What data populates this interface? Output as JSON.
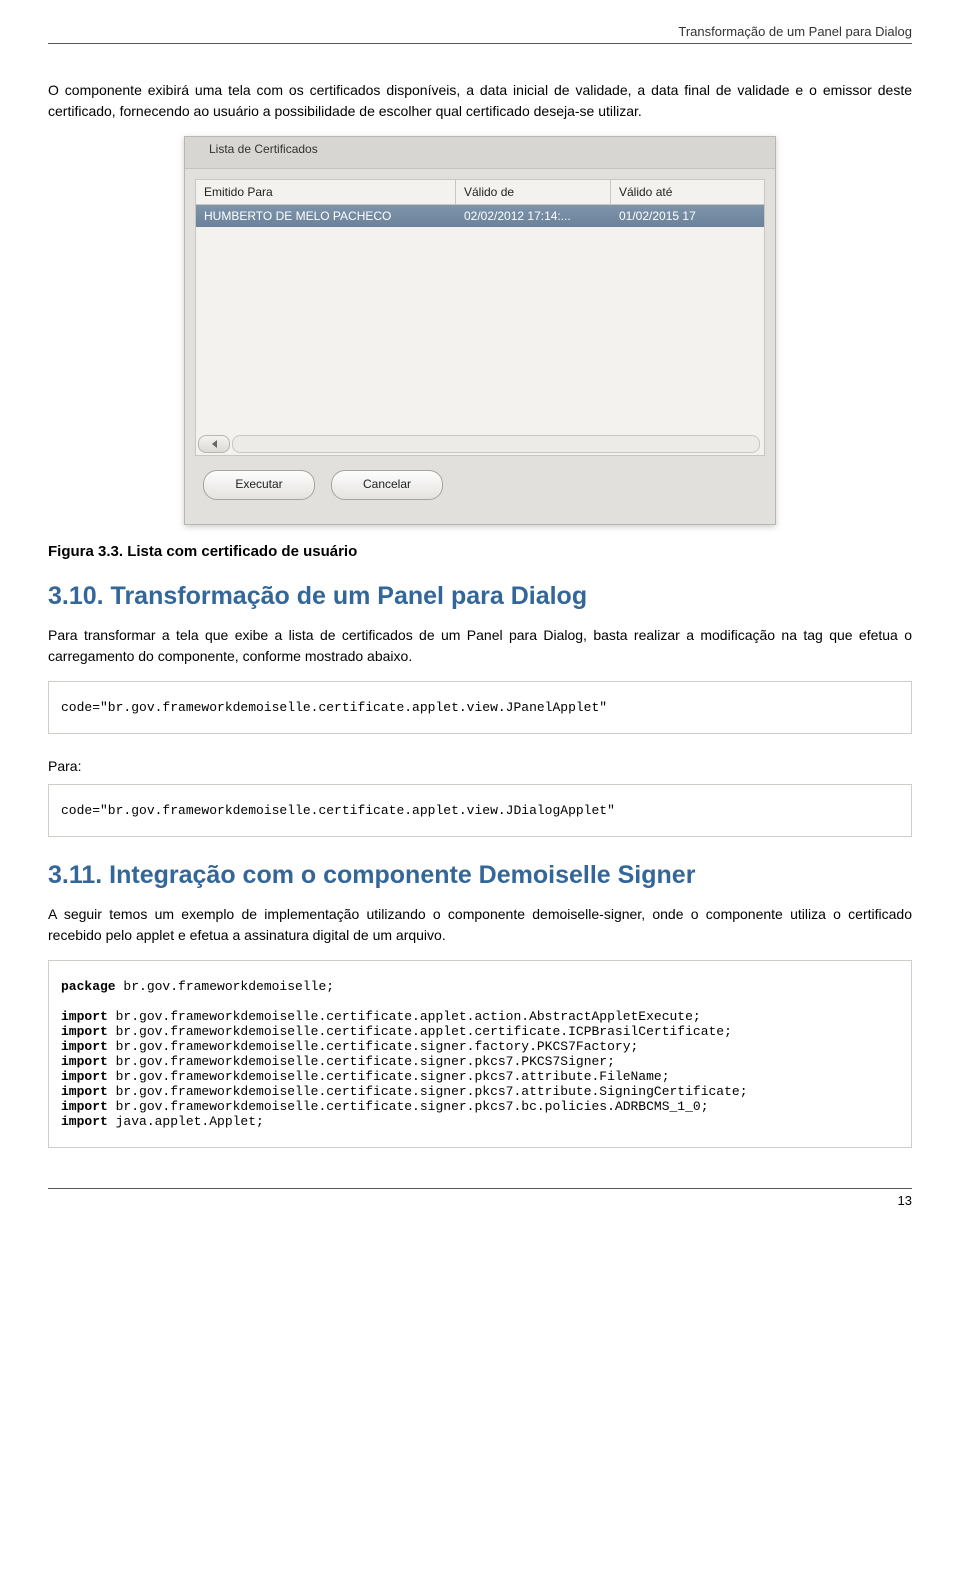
{
  "header": {
    "title": "Transformação de um Panel para Dialog"
  },
  "intro": "O componente exibirá uma tela com os certificados disponíveis, a data inicial de validade, a data final de validade e o emissor deste certificado, fornecendo ao usuário a possibilidade de escolher qual certificado deseja-se utilizar.",
  "dialog": {
    "title": "Lista de Certificados",
    "columns": {
      "c1": "Emitido Para",
      "c2": "Válido de",
      "c3": "Válido até"
    },
    "row": {
      "c1": "HUMBERTO DE MELO PACHECO",
      "c2": "02/02/2012 17:14:...",
      "c3": "01/02/2015 17"
    },
    "btn_exec": "Executar",
    "btn_cancel": "Cancelar"
  },
  "figure_caption": "Figura 3.3. Lista com certificado de usuário",
  "sec310": {
    "heading": "3.10. Transformação de um Panel para Dialog",
    "para": "Para transformar a tela que exibe a lista de certificados de um Panel para Dialog, basta realizar a modificação na tag que efetua o carregamento do componente, conforme mostrado abaixo.",
    "code1": "code=\"br.gov.frameworkdemoiselle.certificate.applet.view.JPanelApplet\"",
    "para_label": "Para:",
    "code2": "code=\"br.gov.frameworkdemoiselle.certificate.applet.view.JDialogApplet\""
  },
  "sec311": {
    "heading": "3.11. Integração com o componente Demoiselle Signer",
    "para": "A seguir temos um exemplo de implementação utilizando o componente demoiselle-signer, onde o componente utiliza o certificado recebido pelo applet e efetua a assinatura digital de um arquivo.",
    "code": {
      "l1a": "package",
      "l1b": " br.gov.frameworkdemoiselle;",
      "l2a": "import",
      "l2b": " br.gov.frameworkdemoiselle.certificate.applet.action.AbstractAppletExecute;",
      "l3a": "import",
      "l3b": " br.gov.frameworkdemoiselle.certificate.applet.certificate.ICPBrasilCertificate;",
      "l4a": "import",
      "l4b": " br.gov.frameworkdemoiselle.certificate.signer.factory.PKCS7Factory;",
      "l5a": "import",
      "l5b": " br.gov.frameworkdemoiselle.certificate.signer.pkcs7.PKCS7Signer;",
      "l6a": "import",
      "l6b": " br.gov.frameworkdemoiselle.certificate.signer.pkcs7.attribute.FileName;",
      "l7a": "import",
      "l7b": " br.gov.frameworkdemoiselle.certificate.signer.pkcs7.attribute.SigningCertificate;",
      "l8a": "import",
      "l8b": " br.gov.frameworkdemoiselle.certificate.signer.pkcs7.bc.policies.ADRBCMS_1_0;",
      "l9a": "import",
      "l9b": " java.applet.Applet;"
    }
  },
  "page_number": "13"
}
